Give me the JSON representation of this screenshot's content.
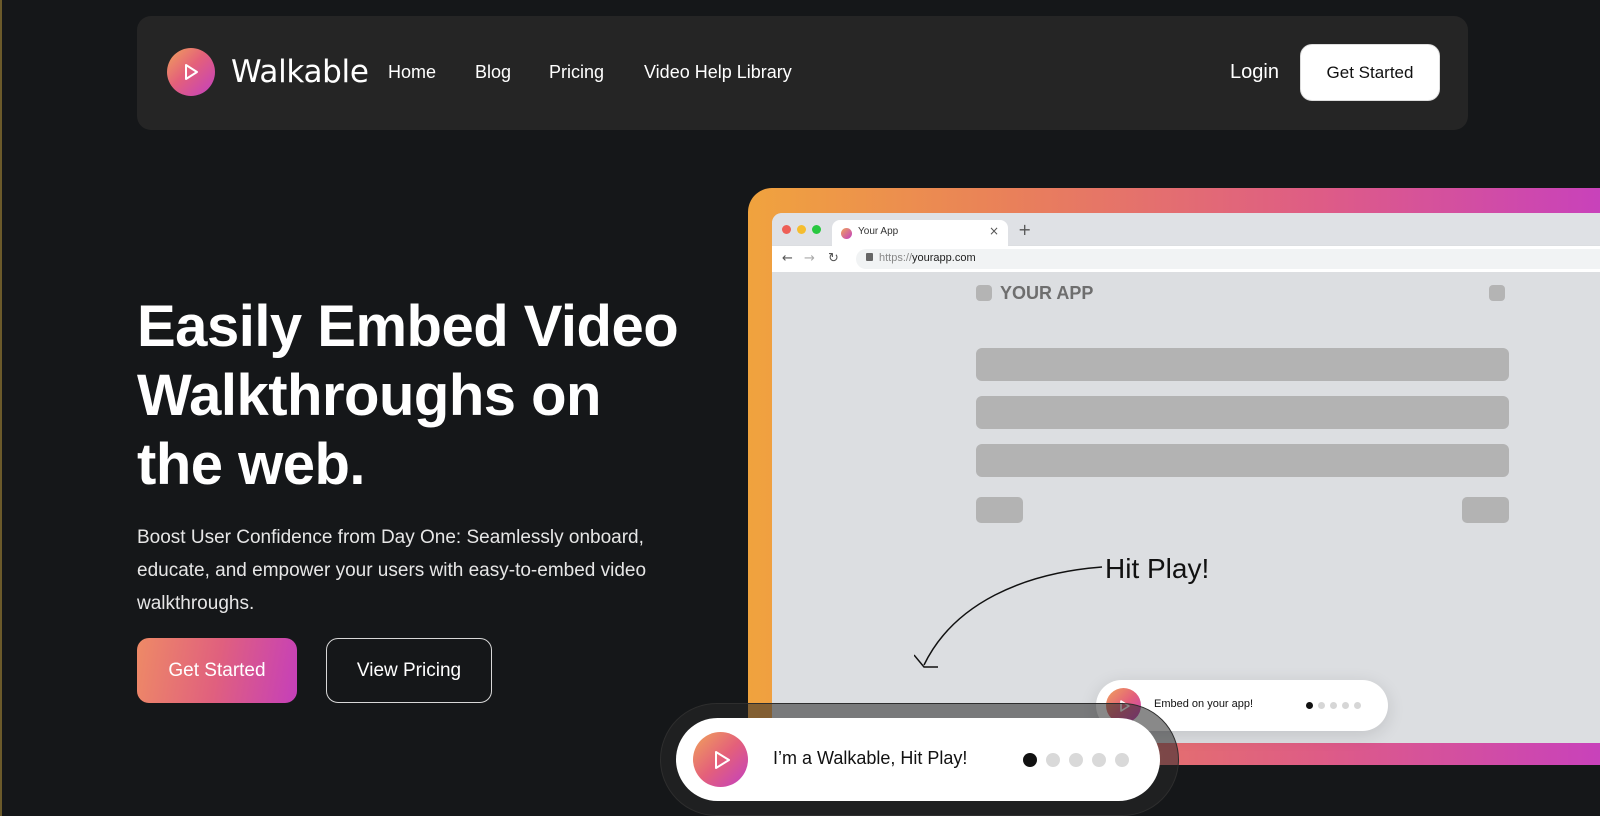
{
  "brand": {
    "name": "Walkable"
  },
  "nav": {
    "links": [
      "Home",
      "Blog",
      "Pricing",
      "Video Help Library"
    ],
    "login": "Login",
    "cta": "Get Started"
  },
  "hero": {
    "title": "Easily Embed Video Walkthroughs on the web.",
    "subtitle": "Boost User Confidence from Day One: Seamlessly onboard, educate, and empower your users with easy-to-embed video walkthroughs.",
    "primary_button": "Get Started",
    "secondary_button": "View Pricing"
  },
  "illustration": {
    "tab_label": "Your App",
    "url_scheme": "https://",
    "url_host": "yourapp.com",
    "app_title": "YOUR APP",
    "callout": "Hit Play!",
    "mini_widget_label": "Embed on your app!",
    "mini_widget_dots": 5,
    "mini_widget_active_dot": 1
  },
  "widget": {
    "label": "I’m a Walkable, Hit Play!",
    "dots": 5,
    "active_dot": 1
  },
  "colors": {
    "background": "#151719",
    "nav_background": "#252525",
    "gradient_start": "#f0a33e",
    "gradient_mid": "#de5c86",
    "gradient_end": "#c63fc0"
  }
}
